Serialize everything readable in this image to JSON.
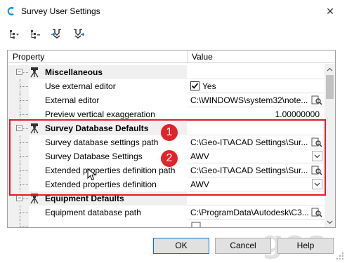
{
  "window": {
    "title": "Survey User Settings",
    "close_glyph": "✕"
  },
  "toolbar": {
    "buttons": [
      "expand-all-icon",
      "collapse-all-icon",
      "import-icon",
      "export-icon"
    ]
  },
  "grid": {
    "columns": {
      "property": "Property",
      "value": "Value"
    },
    "categories": {
      "misc": "Miscellaneous",
      "survey_db": "Survey Database Defaults",
      "equipment": "Equipment Defaults"
    },
    "rows": {
      "use_external_editor": {
        "label": "Use external editor",
        "value": "Yes",
        "checked": true
      },
      "external_editor": {
        "label": "External editor",
        "value": "C:\\WINDOWS\\system32\\note..."
      },
      "preview_vert": {
        "label": "Preview vertical exaggeration",
        "value": "1.00000000"
      },
      "survey_db_path": {
        "label": "Survey database settings path",
        "value": "C:\\Geo-IT\\ACAD Settings\\Sur..."
      },
      "survey_db_settings": {
        "label": "Survey Database Settings",
        "value": "AWV"
      },
      "ext_prop_path": {
        "label": "Extended properties definition path",
        "value": "C:\\Geo-IT\\ACAD Settings\\Sur..."
      },
      "ext_prop_def": {
        "label": "Extended properties definition",
        "value": "AWV"
      },
      "equipment_db_path": {
        "label": "Equipment database path",
        "value": "C:\\ProgramData\\Autodesk\\C3..."
      }
    }
  },
  "annotations": {
    "badge1": "1",
    "badge2": "2",
    "highlight_color": "#e21d24"
  },
  "buttons": {
    "ok": "OK",
    "cancel": "Cancel",
    "help": "Help"
  },
  "watermark": "geo",
  "colors": {
    "accent": "#0078d7",
    "badge": "#e0242b"
  }
}
